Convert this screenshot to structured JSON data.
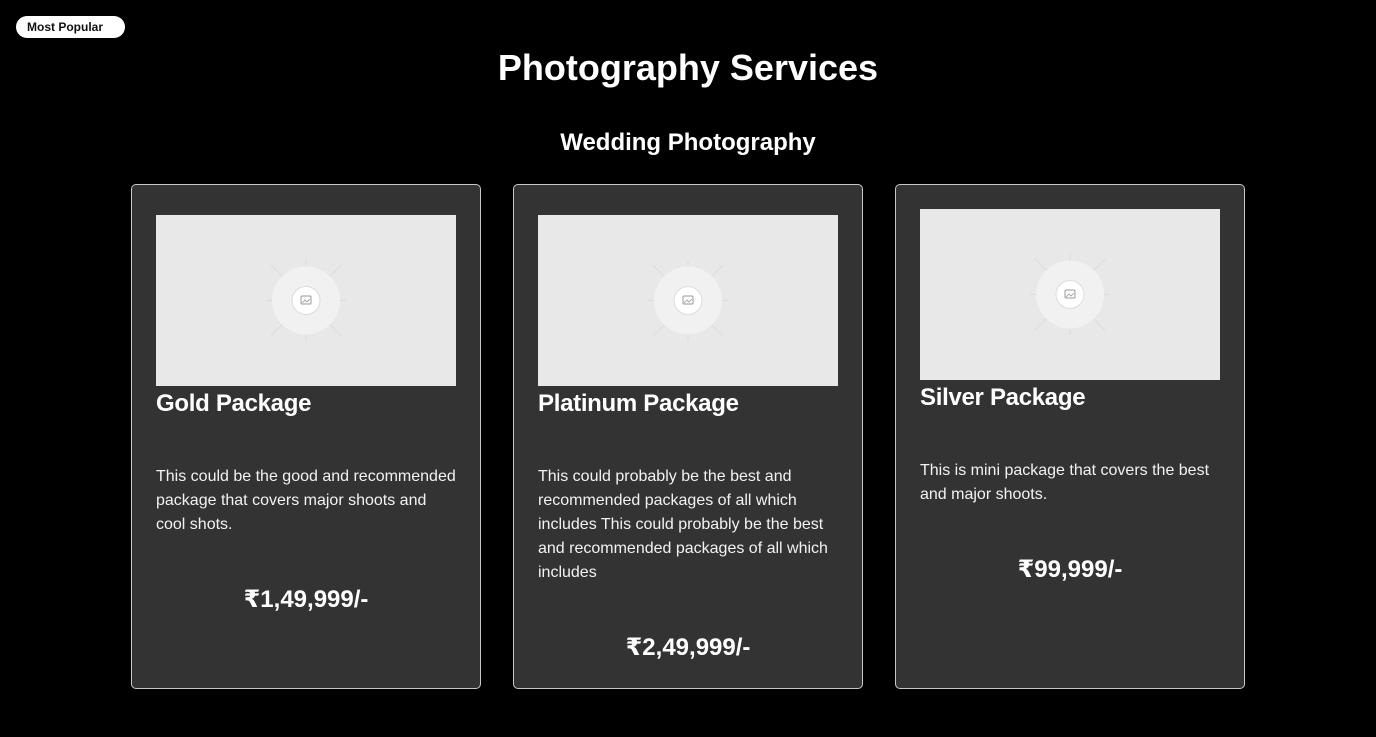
{
  "badge": {
    "label": "Most Popular"
  },
  "header": {
    "title": "Photography Services",
    "subtitle": "Wedding Photography"
  },
  "packages": [
    {
      "name": "Gold Package",
      "description": "This could be the good and recommended package that covers major shoots and cool shots.",
      "price": "₹1,49,999/-",
      "image_icon": "image-placeholder-icon"
    },
    {
      "name": "Platinum Package",
      "description": "This could probably be the best and recommended packages of all which includes This could probably be the best and recommended packages of all which includes",
      "price": "₹2,49,999/-",
      "image_icon": "image-placeholder-icon"
    },
    {
      "name": "Silver Package",
      "description": "This is mini package that covers the best and major shoots.",
      "price": "₹99,999/-",
      "image_icon": "image-placeholder-icon"
    }
  ],
  "colors": {
    "background": "#000000",
    "card_background": "#333333",
    "card_border": "#c8c8c8",
    "image_placeholder": "#e8e8e8",
    "text": "#ffffff"
  }
}
